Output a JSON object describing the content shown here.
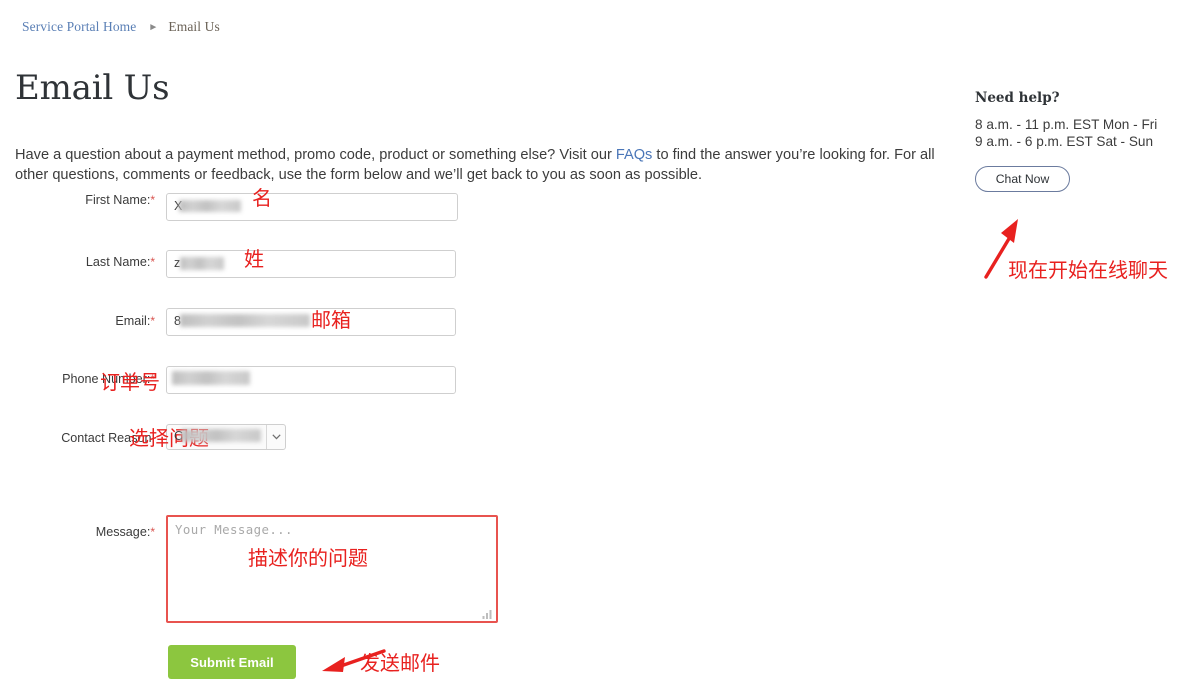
{
  "breadcrumb": {
    "home_label": "Service Portal Home",
    "separator": "►",
    "current_label": "Email Us"
  },
  "page": {
    "title": "Email Us",
    "intro_part1": "Have a question about a payment method, promo code, product or something else? Visit our ",
    "intro_link": "FAQs",
    "intro_part2": " to find the answer you’re looking for. For all other questions, comments or feedback, use the form below and we’ll get back to you as soon as possible."
  },
  "form": {
    "fields": [
      {
        "label": "First Name:",
        "required": true,
        "value_visible": "X",
        "redacted": true
      },
      {
        "label": "Last Name:",
        "required": true,
        "value_visible": "z",
        "redacted": true
      },
      {
        "label": "Email:",
        "required": true,
        "value_visible": "8",
        "redacted": true
      },
      {
        "label": "Phone Number:",
        "required": true,
        "value_visible": "",
        "redacted": true
      },
      {
        "label": "Contact Reason:",
        "required": false,
        "value_visible": "C",
        "redacted": true
      },
      {
        "label": "Message:",
        "required": true,
        "value_visible": "",
        "redacted": false
      }
    ],
    "required_marker": "*",
    "message_placeholder": "Your Message...",
    "submit_label": "Submit Email"
  },
  "rail": {
    "title": "Need help?",
    "hours_line1": "8 a.m. - 11 p.m. EST Mon - Fri",
    "hours_line2": "9 a.m. - 6 p.m. EST Sat - Sun",
    "chat_label": "Chat Now"
  },
  "annotations": {
    "first_name": "名",
    "last_name": "姓",
    "email": "邮箱",
    "phone": "订单号",
    "contact_reason": "选择问题",
    "message": "描述你的问题",
    "submit": "发送邮件",
    "chat": "现在开始在线聊天"
  },
  "colors": {
    "link": "#4a76b8",
    "breadcrumb_link": "#5a7fb5",
    "annotation_red": "#e8211f",
    "required_red": "#d9534f",
    "submit_green": "#8cc63f",
    "textarea_border": "#e8534f",
    "chat_border": "#6b7b9e"
  }
}
